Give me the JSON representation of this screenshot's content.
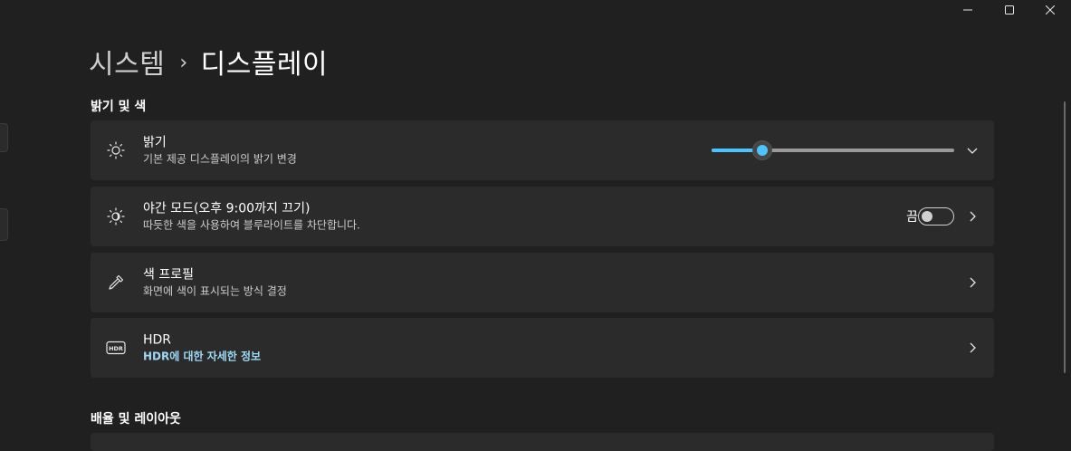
{
  "window": {
    "buttons": {
      "minimize": "minimize-icon",
      "maximize": "maximize-icon",
      "close": "close-icon"
    }
  },
  "breadcrumb": {
    "parent": "시스템",
    "separator": "›",
    "current": "디스플레이"
  },
  "sections": {
    "brightness_color": "밝기 및 색",
    "scale_layout": "배율 및 레이아웃"
  },
  "brightness": {
    "title": "밝기",
    "subtitle": "기본 제공 디스플레이의 밝기 변경",
    "value_percent": 21,
    "icon": "sun-icon",
    "accent": "#4cc2ff"
  },
  "night_mode": {
    "title": "야간 모드(오후 9:00까지 끄기)",
    "subtitle": "따듯한 색을 사용하여 블루라이트를 차단합니다.",
    "state_label": "끔",
    "on": false,
    "icon": "night-light-icon"
  },
  "color_profile": {
    "title": "색 프로필",
    "subtitle": "화면에 색이 표시되는 방식 결정",
    "icon": "color-picker-icon"
  },
  "hdr": {
    "title": "HDR",
    "link": "HDR에 대한 자세한 정보",
    "icon": "hdr-icon",
    "link_color": "#9fd8f5"
  }
}
